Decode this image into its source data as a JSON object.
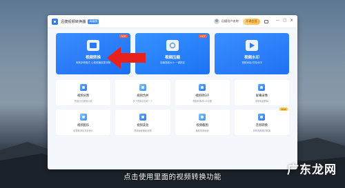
{
  "app": {
    "title": "迅捷视频转换器",
    "version_badge": "高级版",
    "user_label": "迅捷用户名称",
    "vip_label": "开通会员",
    "window_controls": [
      "—",
      "□",
      "✕"
    ]
  },
  "featured": [
    {
      "label": "视频转换",
      "desc": "转换多种格式 让视频播放更流畅",
      "icon": "convert-icon",
      "hot": "HOT"
    },
    {
      "label": "视频压缩",
      "desc": "压缩视频大小 一键搞定",
      "icon": "camera-icon",
      "hot": "HOT"
    },
    {
      "label": "视频水印",
      "desc": "视频添加/去除水印",
      "icon": "film-icon",
      "hot": ""
    }
  ],
  "tools": [
    {
      "label": "视频分割",
      "desc": "快速分割视频片段",
      "icon": "cut-icon",
      "badge": ""
    },
    {
      "label": "视频合并",
      "desc": "多个视频合并成一个",
      "icon": "merge-icon",
      "badge": ""
    },
    {
      "label": "视频转GIF",
      "desc": "视频转换成GIF动图",
      "icon": "gif-icon",
      "badge": ""
    },
    {
      "label": "屏幕录像",
      "desc": "录制电脑屏幕",
      "icon": "record-icon",
      "badge": ""
    },
    {
      "label": "视频配乐",
      "desc": "给视频添加背景音乐",
      "icon": "music-icon",
      "badge": ""
    },
    {
      "label": "视频美化",
      "desc": "视频画面美化处理",
      "icon": "beautify-icon",
      "badge": ""
    },
    {
      "label": "视频截图",
      "desc": "截取视频画面",
      "icon": "screenshot-icon",
      "badge": ""
    },
    {
      "label": "音频转换",
      "desc": "多种音频格式转换",
      "icon": "audio-icon",
      "badge": "NEW"
    }
  ],
  "overlay": {
    "subtitle": "点击使用里面的视频转换功能",
    "watermark": "广东龙网"
  },
  "colors": {
    "accent": "#1c73f4",
    "hot": "#ff5a3d",
    "arrow": "#e8211c"
  }
}
